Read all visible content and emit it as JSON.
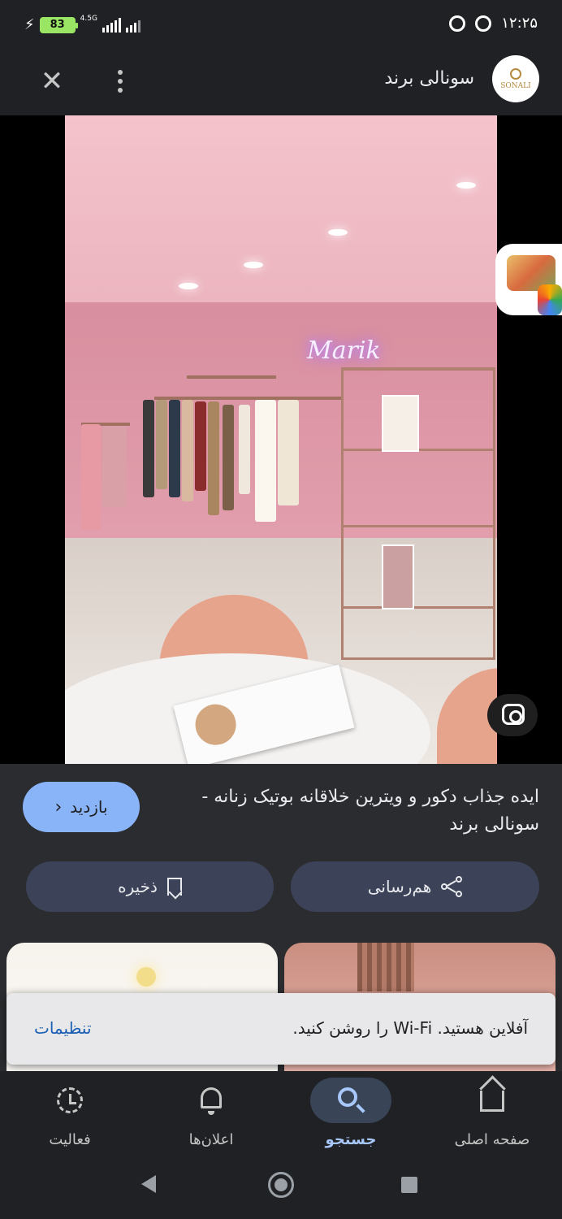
{
  "status_bar": {
    "battery": "83",
    "network": "4.5G",
    "time": "۱۲:۲۵"
  },
  "header": {
    "site_name": "سونالی برند",
    "logo_text": "SONALI"
  },
  "result": {
    "title": "ایده جذاب دکور و ویترین خلاقانه بوتیک زنانه - سونالی برند",
    "visit_label": "بازدید",
    "share_label": "هم‌رسانی",
    "save_label": "ذخیره"
  },
  "snackbar": {
    "message": "آفلاین هستید. Wi-Fi را روشن کنید.",
    "action": "تنظیمات"
  },
  "bottom_nav": {
    "items": [
      {
        "label": "صفحه اصلی",
        "icon": "home-icon"
      },
      {
        "label": "جستجو",
        "icon": "search-icon",
        "active": true
      },
      {
        "label": "اعلان‌ها",
        "icon": "bell-icon"
      },
      {
        "label": "فعالیت",
        "icon": "activity-icon"
      }
    ]
  },
  "colors": {
    "accent": "#8ab4f8",
    "active_nav": "#a8c7fa",
    "surface": "#2b2c2f",
    "background": "#202124"
  }
}
